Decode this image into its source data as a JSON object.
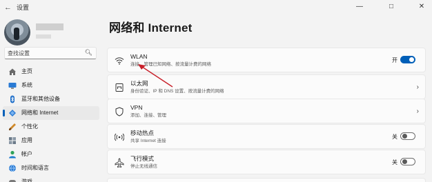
{
  "window": {
    "title": "设置"
  },
  "sidebar": {
    "search_placeholder": "查找设置",
    "items": [
      {
        "label": "主页",
        "icon": "home-icon",
        "active": false
      },
      {
        "label": "系统",
        "icon": "monitor-icon",
        "active": false
      },
      {
        "label": "蓝牙和其他设备",
        "icon": "bluetooth-icon",
        "active": false
      },
      {
        "label": "网络和 Internet",
        "icon": "wifi-diamond-icon",
        "active": true
      },
      {
        "label": "个性化",
        "icon": "brush-icon",
        "active": false
      },
      {
        "label": "应用",
        "icon": "apps-icon",
        "active": false
      },
      {
        "label": "帐户",
        "icon": "person-icon",
        "active": false
      },
      {
        "label": "时间和语言",
        "icon": "globe-clock-icon",
        "active": false
      },
      {
        "label": "游戏",
        "icon": "gamepad-icon",
        "active": false
      }
    ]
  },
  "main": {
    "title": "网络和 Internet",
    "cards": [
      {
        "title": "WLAN",
        "subtitle": "连接、管理已知网络、按流量计费的网络",
        "icon": "wifi-icon",
        "toggle": true,
        "toggle_label": "开"
      },
      {
        "title": "以太网",
        "subtitle": "身份验证、IP 和 DNS 设置、按流量计费的网络",
        "icon": "ethernet-icon"
      },
      {
        "title": "VPN",
        "subtitle": "添加、连接、管理",
        "icon": "shield-icon"
      },
      {
        "title": "移动热点",
        "subtitle": "共享 Internet 连接",
        "icon": "hotspot-icon",
        "toggle": false,
        "toggle_label": "关"
      },
      {
        "title": "飞行模式",
        "subtitle": "停止无线通信",
        "icon": "airplane-icon",
        "toggle": false,
        "toggle_label": "关"
      }
    ]
  },
  "colors": {
    "accent": "#005fb8",
    "annotation": "#c8202a"
  }
}
